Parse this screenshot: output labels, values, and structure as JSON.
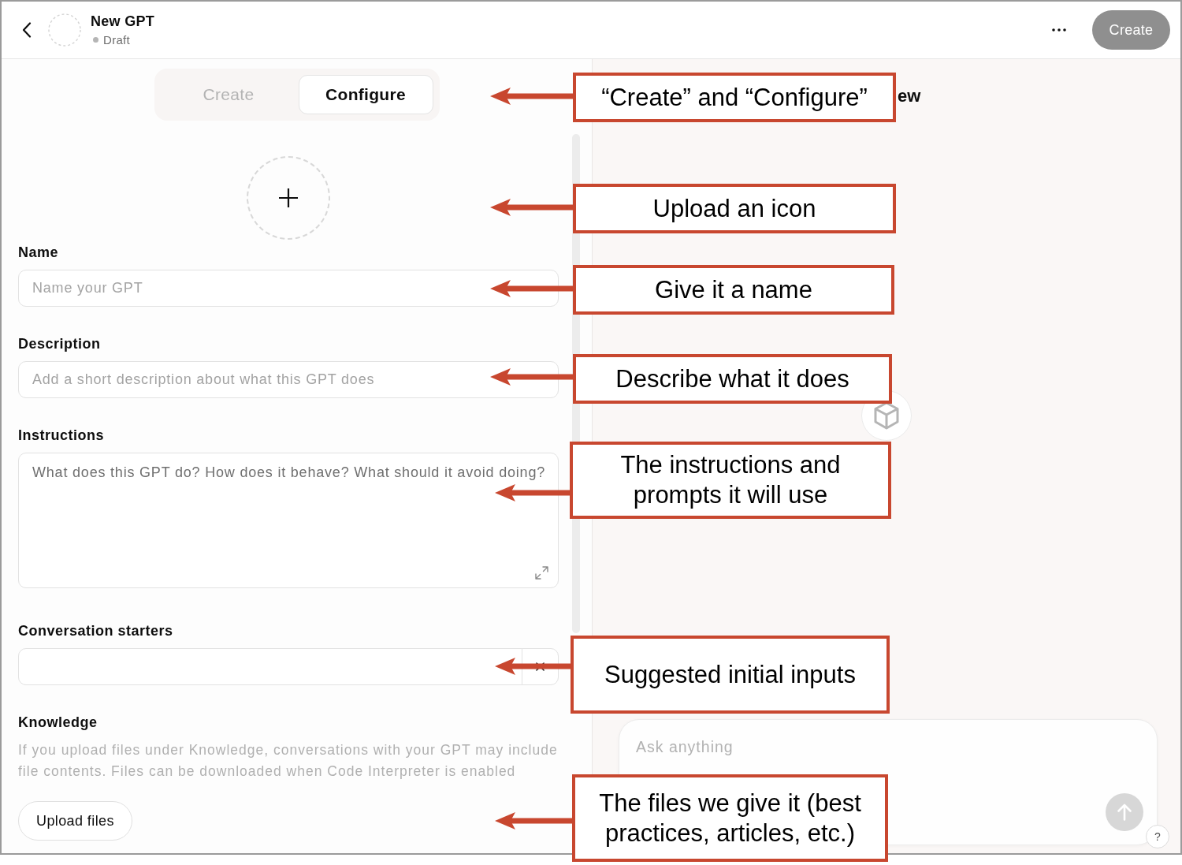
{
  "header": {
    "title": "New GPT",
    "status": "Draft",
    "create_button": {
      "label": "Create",
      "disabled": true
    }
  },
  "tabs": [
    {
      "label": "Create",
      "selected": false
    },
    {
      "label": "Configure",
      "selected": true
    }
  ],
  "fields": [
    {
      "kind": "input",
      "label": "Name",
      "placeholder": "Name your GPT"
    },
    {
      "kind": "input",
      "label": "Description",
      "placeholder": "Add a short description about what this GPT does"
    },
    {
      "kind": "textarea",
      "label": "Instructions",
      "placeholder": "What does this GPT do? How does it behave? What should it avoid doing?"
    },
    {
      "kind": "starter",
      "label": "Conversation starters"
    }
  ],
  "knowledge": {
    "label": "Knowledge",
    "note": "If you upload files under Knowledge, conversations with your GPT may include file contents. Files can be downloaded when Code Interpreter is enabled",
    "button": "Upload files"
  },
  "preview": {
    "heading": "ew",
    "composer": {
      "placeholder": "Ask anything"
    },
    "help_button": "?"
  },
  "annotations": [
    {
      "text": "“Create” and “Configure”"
    },
    {
      "text": "Upload an icon"
    },
    {
      "text": "Give it a name"
    },
    {
      "text": "Describe what it does"
    },
    {
      "text": "The instructions and prompts it will use"
    },
    {
      "text": "Suggested initial inputs"
    },
    {
      "text": "The files we give it (best practices, articles, etc.)"
    }
  ]
}
